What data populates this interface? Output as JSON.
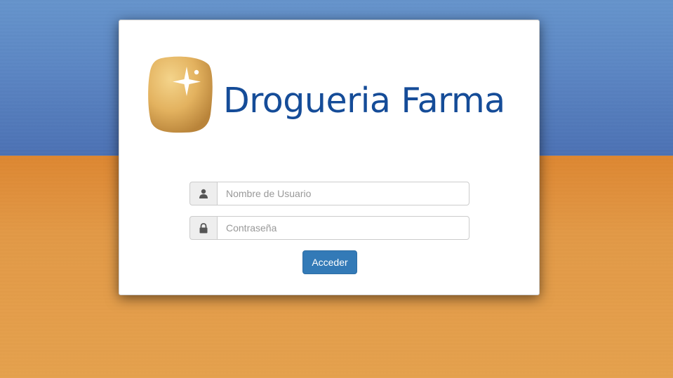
{
  "brand": {
    "name": "Drogueria Farma",
    "logo_icon": "sparkle-potato-icon",
    "text_color": "#154c98",
    "mark_color": "#e3b25f"
  },
  "login": {
    "username": {
      "icon": "user-icon",
      "placeholder": "Nombre de Usuario",
      "value": ""
    },
    "password": {
      "icon": "lock-icon",
      "placeholder": "Contraseña",
      "value": ""
    },
    "submit_label": "Acceder",
    "submit_color": "#337ab7"
  },
  "background": {
    "top_color": "#5a86c6",
    "bottom_color": "#e8a24c"
  }
}
